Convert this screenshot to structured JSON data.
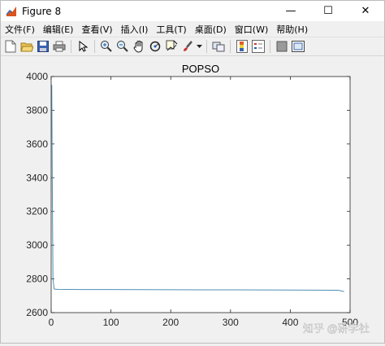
{
  "window": {
    "title": "Figure 8",
    "minimize_glyph": "—",
    "maximize_glyph": "☐",
    "close_glyph": "✕"
  },
  "menu": [
    {
      "label": "文件(F)"
    },
    {
      "label": "编辑(E)"
    },
    {
      "label": "查看(V)"
    },
    {
      "label": "插入(I)"
    },
    {
      "label": "工具(T)"
    },
    {
      "label": "桌面(D)"
    },
    {
      "label": "窗口(W)"
    },
    {
      "label": "帮助(H)"
    }
  ],
  "toolbar": {
    "icons": [
      "new-figure-icon",
      "open-file-icon",
      "save-icon",
      "print-icon",
      "edit-plot-arrow-icon",
      "zoom-in-icon",
      "zoom-out-icon",
      "pan-hand-icon",
      "rotate-3d-icon",
      "data-cursor-icon",
      "brush-icon",
      "brush-dropdown-icon",
      "link-plot-icon",
      "insert-colorbar-icon",
      "insert-legend-icon",
      "hide-plot-tools-icon",
      "show-plot-tools-icon"
    ]
  },
  "watermark": "知乎 @研学社",
  "chart_data": {
    "type": "line",
    "title": "POPSO",
    "xlabel": "",
    "ylabel": "",
    "xlim": [
      0,
      500
    ],
    "ylim": [
      2600,
      4000
    ],
    "xticks": [
      "0",
      "100",
      "200",
      "300",
      "400",
      "500"
    ],
    "yticks": [
      "2600",
      "2800",
      "3000",
      "3200",
      "3400",
      "3600",
      "3800",
      "4000"
    ],
    "grid": false,
    "series": [
      {
        "color": "#4e8fb5",
        "x": [
          1,
          2,
          3,
          5,
          10,
          50,
          100,
          200,
          300,
          400,
          480,
          490
        ],
        "y": [
          3950,
          3300,
          2800,
          2740,
          2738,
          2737,
          2737,
          2736,
          2735,
          2734,
          2733,
          2725
        ]
      }
    ]
  }
}
